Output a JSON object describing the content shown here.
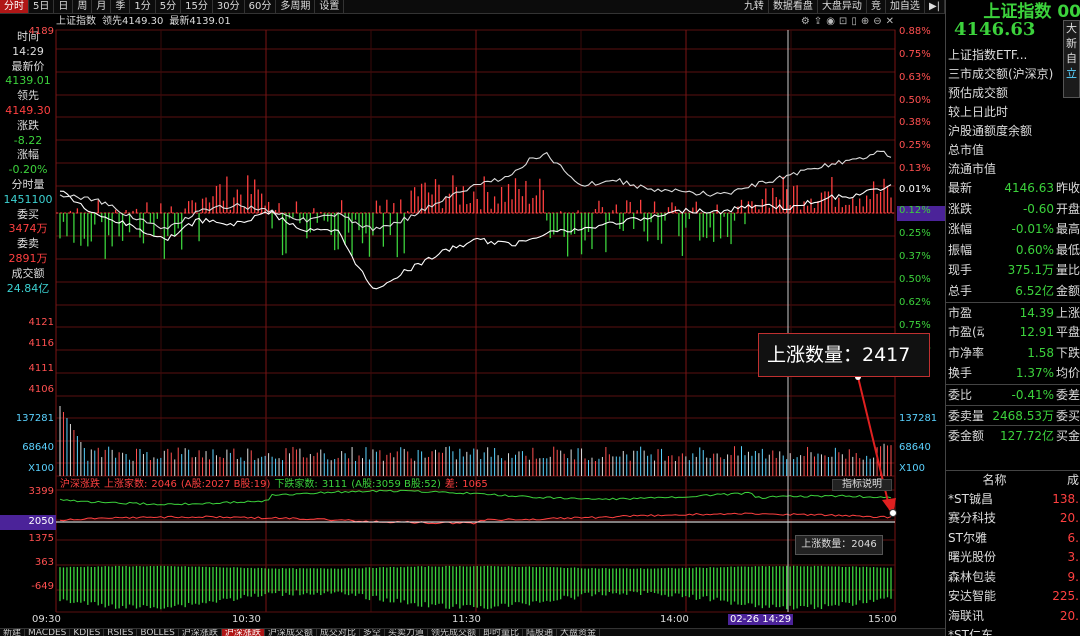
{
  "topbar": {
    "tabs": [
      "分时",
      "5日",
      "日",
      "周",
      "月",
      "季",
      "1分",
      "5分",
      "15分",
      "30分",
      "60分",
      "多周期",
      "设置"
    ],
    "right": [
      "九转",
      "数据看盘",
      "大盘异动",
      "竞",
      "加自选",
      "▶|"
    ]
  },
  "info": {
    "name": "上证指数",
    "lead_label": "领先",
    "lead": "4149.30",
    "last_label": "最新",
    "last": "4139.01"
  },
  "left": {
    "rows": [
      [
        "时间",
        "14:29",
        ""
      ],
      [
        "最新价",
        "4139.01",
        "green"
      ],
      [
        "领先",
        "4149.30",
        "red"
      ],
      [
        "涨跌",
        "-8.22",
        "green"
      ],
      [
        "涨幅",
        "-0.20%",
        "green"
      ],
      [
        "分时量",
        "1451100",
        "cyan"
      ],
      [
        "委买",
        "3474万",
        "red"
      ],
      [
        "委卖",
        "2891万",
        "red"
      ],
      [
        "成交额",
        "24.84亿",
        "cyan"
      ]
    ]
  },
  "axes": {
    "left_price": [
      "4189",
      "4121",
      "4116",
      "4111",
      "4106"
    ],
    "right_pct": [
      "0.88%",
      "0.75%",
      "0.63%",
      "0.50%",
      "0.38%",
      "0.25%",
      "0.13%",
      "0.01%",
      "0.12%",
      "0.25%",
      "0.37%",
      "0.50%",
      "0.62%",
      "0.75%",
      "0.87%"
    ],
    "vol_left": [
      "137281",
      "68640",
      "X100"
    ],
    "vol_right": [
      "137281",
      "68640",
      "X100"
    ],
    "breadth_left": [
      "3399",
      "2050",
      "1375",
      "363",
      "-649"
    ],
    "time": [
      "09:30",
      "10:30",
      "11:30",
      "14:00",
      "15:00"
    ],
    "cursor_time": "02-26 14:29"
  },
  "breadth": {
    "title": "沪深涨跌",
    "up_label": "上涨家数:",
    "up": "2046",
    "up_detail": "(A股:2027 B股:19)",
    "down_label": "下跌家数:",
    "down": "3111",
    "down_detail": "(A股:3059 B股:52)",
    "diff_label": "差:",
    "diff": "1065",
    "explain": "指标说明"
  },
  "tooltips": {
    "main": "上涨数量：2417",
    "small": "上涨数量：2046"
  },
  "right_panel": {
    "title": "上证指数 00",
    "price": "4146.63",
    "items": [
      "上证指数ETF...",
      "三市成交额(沪深京)",
      "预估成交额",
      "较上日此时",
      "沪股通额度余额",
      "总市值",
      "流通市值"
    ],
    "grid": [
      [
        "最新",
        "4146.63",
        "昨收"
      ],
      [
        "涨跌",
        "-0.60",
        "开盘"
      ],
      [
        "涨幅",
        "-0.01%",
        "最高"
      ],
      [
        "振幅",
        "0.60%",
        "最低"
      ],
      [
        "现手",
        "375.1万",
        "量比"
      ],
      [
        "总手",
        "6.52亿",
        "金额"
      ],
      [
        "市盈",
        "14.39",
        "上涨"
      ],
      [
        "市盈(动)",
        "12.91",
        "平盘"
      ],
      [
        "市净率",
        "1.58",
        "下跌"
      ],
      [
        "换手",
        "1.37%",
        "均价"
      ],
      [
        "委比",
        "-0.41%",
        "委差"
      ],
      [
        "委卖量",
        "2468.53万",
        "委买"
      ],
      [
        "委金额",
        "127.72亿",
        "买金"
      ]
    ],
    "stock_header": [
      "名称",
      "成"
    ],
    "stocks": [
      [
        "*ST铖昌",
        "138."
      ],
      [
        "赛分科技",
        "20."
      ],
      [
        "ST尔雅",
        "6."
      ],
      [
        "曙光股份",
        "3."
      ],
      [
        "森林包装",
        "9."
      ],
      [
        "安达智能",
        "225."
      ],
      [
        "海联讯",
        "20."
      ],
      [
        "*ST仁东",
        ""
      ]
    ]
  },
  "sidebox": [
    "大",
    "新",
    "自",
    "立"
  ],
  "bottombar": [
    "新建",
    "MACDES",
    "KDJES",
    "RSIES",
    "BOLLES",
    "沪深涨跌",
    "沪深涨跌",
    "沪深成交额",
    "成交对比",
    "多空",
    "买卖力道",
    "领先成交额",
    "即时量比",
    "陆股通",
    "大盘资金"
  ],
  "colors": {
    "up": "#ff4040",
    "down": "#3cd23c",
    "accent": "#4b2399",
    "grid": "#5a0f0f"
  }
}
